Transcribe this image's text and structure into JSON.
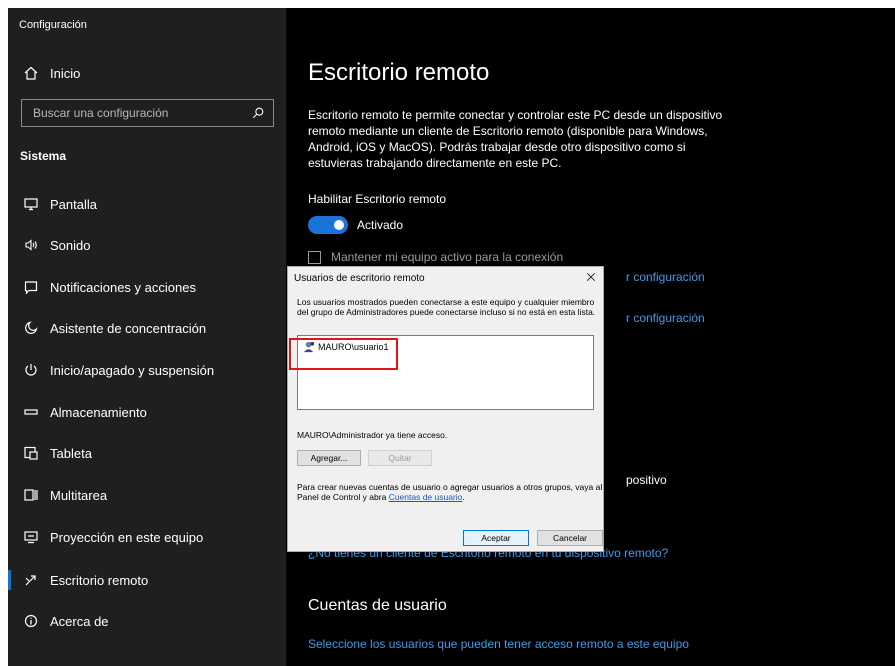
{
  "window": {
    "title": "Configuración"
  },
  "sidebar": {
    "home_label": "Inicio",
    "search_placeholder": "Buscar una configuración",
    "section": "Sistema",
    "items": [
      {
        "label": "Pantalla",
        "icon": "monitor-icon"
      },
      {
        "label": "Sonido",
        "icon": "speaker-icon"
      },
      {
        "label": "Notificaciones y acciones",
        "icon": "notification-icon"
      },
      {
        "label": "Asistente de concentración",
        "icon": "moon-icon"
      },
      {
        "label": "Inicio/apagado y suspensión",
        "icon": "power-icon"
      },
      {
        "label": "Almacenamiento",
        "icon": "storage-icon"
      },
      {
        "label": "Tableta",
        "icon": "tablet-icon"
      },
      {
        "label": "Multitarea",
        "icon": "multitask-icon"
      },
      {
        "label": "Proyección en este equipo",
        "icon": "projection-icon"
      },
      {
        "label": "Escritorio remoto",
        "icon": "remote-desktop-icon",
        "selected": true
      },
      {
        "label": "Acerca de",
        "icon": "info-icon"
      }
    ]
  },
  "main": {
    "title": "Escritorio remoto",
    "description": "Escritorio remoto te permite conectar y controlar este PC desde un dispositivo remoto mediante un cliente de Escritorio remoto (disponible para Windows, Android, iOS y MacOS). Podrás trabajar desde otro dispositivo como si estuvieras trabajando directamente en este PC.",
    "enable_label": "Habilitar Escritorio remoto",
    "toggle_state": "Activado",
    "toggle_on": true,
    "keep_awake_label": "Mantener mi equipo activo para la conexión",
    "link_config_1": "r configuración",
    "link_config_2": "r configuración",
    "partial_text": "positivo",
    "link_client": "¿No tienes un cliente de Escritorio remoto en tu dispositivo remoto?",
    "users_section_title": "Cuentas de usuario",
    "users_link": "Seleccione los usuarios que pueden tener acceso remoto a este equipo"
  },
  "dialog": {
    "title": "Usuarios de escritorio remoto",
    "description": "Los usuarios mostrados pueden conectarse a este equipo y cualquier miembro del grupo de Administradores puede conectarse incluso si no está en esta lista.",
    "users": [
      "MAURO\\usuario1"
    ],
    "access_note": "MAURO\\Administrador ya tiene acceso.",
    "add_button": "Agregar...",
    "remove_button": "Quitar",
    "help_text": "Para crear nuevas cuentas de usuario o agregar usuarios a otros grupos, vaya al Panel de Control y abra",
    "help_link": "Cuentas de usuario",
    "help_end": ".",
    "ok_button": "Aceptar",
    "cancel_button": "Cancelar"
  },
  "colors": {
    "accent": "#0a74d9",
    "link": "#3d9bea",
    "highlight": "#e01616"
  }
}
